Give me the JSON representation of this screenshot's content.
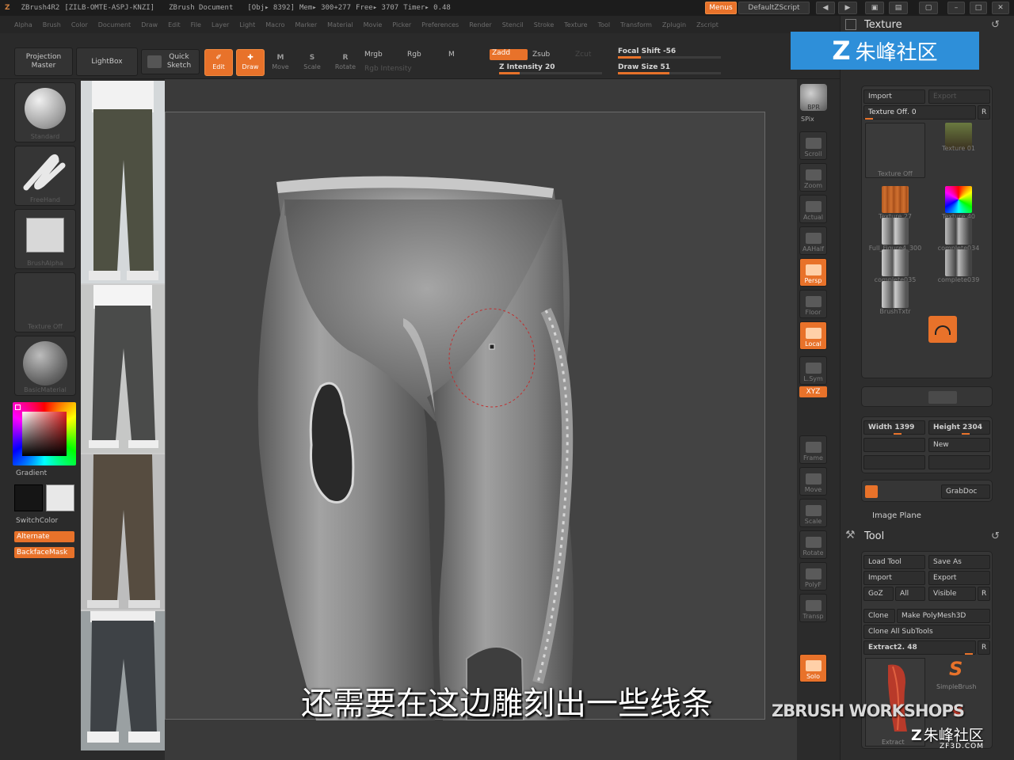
{
  "titlebar": {
    "app": "ZBrush4R2",
    "build": "[ZILB-OMTE-ASPJ-KNZI]",
    "document": "ZBrush Document",
    "obj": "[Obj▸ 8392]",
    "mem": "Mem▸ 300+277",
    "free": "Free▸ 3707",
    "timer": "Timer▸ 0.48",
    "menus_btn": "Menus",
    "script": "DefaultZScript"
  },
  "menubar": [
    "Alpha",
    "Brush",
    "Color",
    "Document",
    "Draw",
    "Edit",
    "File",
    "Layer",
    "Light",
    "Macro",
    "Marker",
    "Material",
    "Movie",
    "Picker",
    "Preferences",
    "Render",
    "Stencil",
    "Stroke",
    "Texture",
    "Tool",
    "Transform",
    "Zplugin",
    "Zscript"
  ],
  "shelf": {
    "projection_master": "Projection Master",
    "lightbox": "LightBox",
    "quick_sketch": "Quick Sketch",
    "edit": "Edit",
    "draw": "Draw",
    "move": "Move",
    "scale": "Scale",
    "rotate": "Rotate",
    "mrgb": "Mrgb",
    "rgb": "Rgb",
    "m": "M",
    "zadd": "Zadd",
    "zsub": "Zsub",
    "zcut": "Zcut",
    "rgb_intensity": "Rgb Intensity",
    "z_intensity_label": "Z Intensity",
    "z_intensity": 20,
    "focal_shift_label": "Focal Shift",
    "focal_shift": -56,
    "draw_size_label": "Draw Size",
    "draw_size": 51
  },
  "left": {
    "brush": "Standard",
    "stroke": "FreeHand",
    "alpha": "BrushAlpha",
    "texture": "Texture Off",
    "material": "BasicMaterial",
    "gradient": "Gradient",
    "switchcolor": "SwitchColor",
    "alternate": "Alternate",
    "backface": "BackfaceMask"
  },
  "rtool": [
    {
      "label": "SPix",
      "on": false
    },
    {
      "label": "Scroll",
      "on": false
    },
    {
      "label": "Zoom",
      "on": false
    },
    {
      "label": "Actual",
      "on": false
    },
    {
      "label": "AAHalf",
      "on": false
    },
    {
      "label": "Persp",
      "on": true
    },
    {
      "label": "Floor",
      "on": false
    },
    {
      "label": "Local",
      "on": true
    },
    {
      "label": "L.Sym",
      "on": false
    },
    {
      "label": "Frame",
      "on": false
    },
    {
      "label": "Move",
      "on": false
    },
    {
      "label": "Scale",
      "on": false
    },
    {
      "label": "Rotate",
      "on": false
    },
    {
      "label": "PolyF",
      "on": false
    },
    {
      "label": "Transp",
      "on": false
    },
    {
      "label": "Solo",
      "on": true
    }
  ],
  "rtool_bpr": "BPR",
  "rtool_xyz": "XYZ",
  "texture_panel": {
    "title": "Texture",
    "import": "Import",
    "export": "Export",
    "texture_off": "Texture Off. 0",
    "r": "R",
    "thumbs": [
      "Texture Off",
      "Texture 01",
      "Texture 27",
      "Texture 40",
      "Full_Figure4_300",
      "complete034",
      "complete035",
      "complete039",
      "BrushTxtr"
    ],
    "width_label": "Width",
    "width": 1399,
    "height_label": "Height",
    "height": 2304,
    "new": "New",
    "grabdoc": "GrabDoc",
    "image_plane": "Image Plane"
  },
  "tool_panel": {
    "title": "Tool",
    "load_tool": "Load Tool",
    "save_as": "Save As",
    "import": "Import",
    "export": "Export",
    "goz": "GoZ",
    "all": "All",
    "visible": "Visible",
    "r": "R",
    "clone": "Clone",
    "make_polymesh": "Make PolyMesh3D",
    "clone_all": "Clone All SubTools",
    "current_tool": "Extract2. 48",
    "simplebrush": "SimpleBrush",
    "extract": "Extract"
  },
  "subtitle": "还需要在这边雕刻出一些线条",
  "watermarks": {
    "top": "朱峰社区",
    "workshops": "ZBRUSH WORKSHOPS",
    "bottom": "朱峰社区",
    "bottom_url": "ZF3D.COM"
  },
  "colors": {
    "accent": "#e8722a",
    "panel": "#2d2d2d",
    "watermark_blue": "#2e8fd9"
  }
}
